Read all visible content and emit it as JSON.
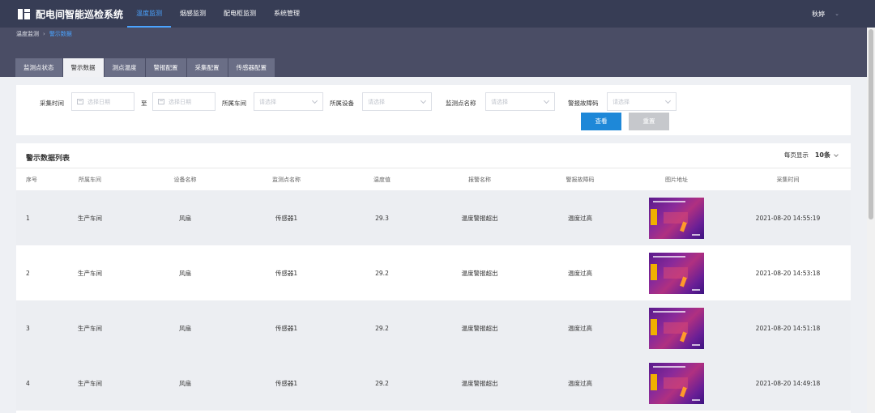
{
  "app": {
    "title": "配电间智能巡检系统"
  },
  "nav": [
    "温度监测",
    "烟感监测",
    "配电柜监测",
    "系统管理"
  ],
  "user": {
    "name": "秋婷"
  },
  "breadcrumb": {
    "root": "温度监测",
    "current": "警示数据"
  },
  "tabs": [
    "监测点状态",
    "警示数据",
    "测点温度",
    "警报配置",
    "采集配置",
    "传感器配置"
  ],
  "filters": {
    "collect_time_label": "采集时间",
    "date_placeholder": "选择日期",
    "to_label": "至",
    "workshop_label": "所属车间",
    "device_label": "所属设备",
    "point_label": "监测点名称",
    "fault_code_label": "警报故障码",
    "select_placeholder": "请选择",
    "query_button": "查看",
    "reset_button": "重置"
  },
  "table": {
    "title": "警示数据列表",
    "page_size_label": "每页显示",
    "page_size_value": "10条",
    "columns": [
      "序号",
      "所属车间",
      "设备名称",
      "监测点名称",
      "温度值",
      "报警名称",
      "警报故障码",
      "图片地址",
      "采集时间"
    ],
    "rows": [
      {
        "no": "1",
        "workshop": "生产车间",
        "device": "风扇",
        "point": "传感器1",
        "temp": "29.3",
        "alarm": "温度警报超出",
        "code": "温度过高",
        "time": "2021-08-20 14:55:19"
      },
      {
        "no": "2",
        "workshop": "生产车间",
        "device": "风扇",
        "point": "传感器1",
        "temp": "29.2",
        "alarm": "温度警报超出",
        "code": "温度过高",
        "time": "2021-08-20 14:53:18"
      },
      {
        "no": "3",
        "workshop": "生产车间",
        "device": "风扇",
        "point": "传感器1",
        "temp": "29.2",
        "alarm": "温度警报超出",
        "code": "温度过高",
        "time": "2021-08-20 14:51:18"
      },
      {
        "no": "4",
        "workshop": "生产车间",
        "device": "风扇",
        "point": "传感器1",
        "temp": "29.2",
        "alarm": "温度警报超出",
        "code": "温度过高",
        "time": "2021-08-20 14:49:18"
      }
    ]
  },
  "colors": {
    "topbar": "#373d55",
    "accent": "#1e88d8",
    "link": "#4aa3ff"
  }
}
